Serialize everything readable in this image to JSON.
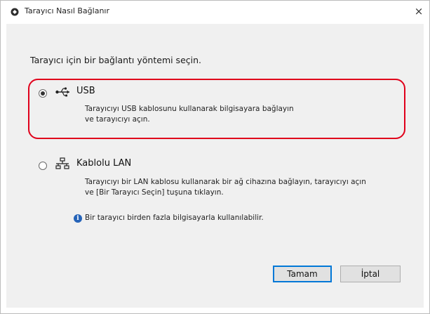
{
  "window": {
    "title": "Tarayıcı Nasıl Bağlanır",
    "close_glyph": "×"
  },
  "dialog": {
    "instruction": "Tarayıcı için bir bağlantı yöntemi seçin.",
    "options": [
      {
        "label": "USB",
        "icon": "usb-icon",
        "selected": true,
        "desc_line1": "Tarayıcıyı USB kablosunu kullanarak bilgisayara bağlayın",
        "desc_line2": "ve tarayıcıyı açın."
      },
      {
        "label": "Kablolu LAN",
        "icon": "network-icon",
        "selected": false,
        "desc_line1": "Tarayıcıyı bir LAN kablosu kullanarak bir ağ cihazına bağlayın, tarayıcıyı açın",
        "desc_line2": "ve [Bir Tarayıcı Seçin] tuşuna tıklayın."
      }
    ],
    "info_text": "Bir tarayıcı birden fazla bilgisayarla kullanılabilir.",
    "info_icon": "info-icon"
  },
  "buttons": {
    "ok": "Tamam",
    "cancel": "İptal"
  },
  "colors": {
    "highlight": "#e0001b",
    "default_button_border": "#0078d7",
    "info_icon": "#2563b8"
  }
}
